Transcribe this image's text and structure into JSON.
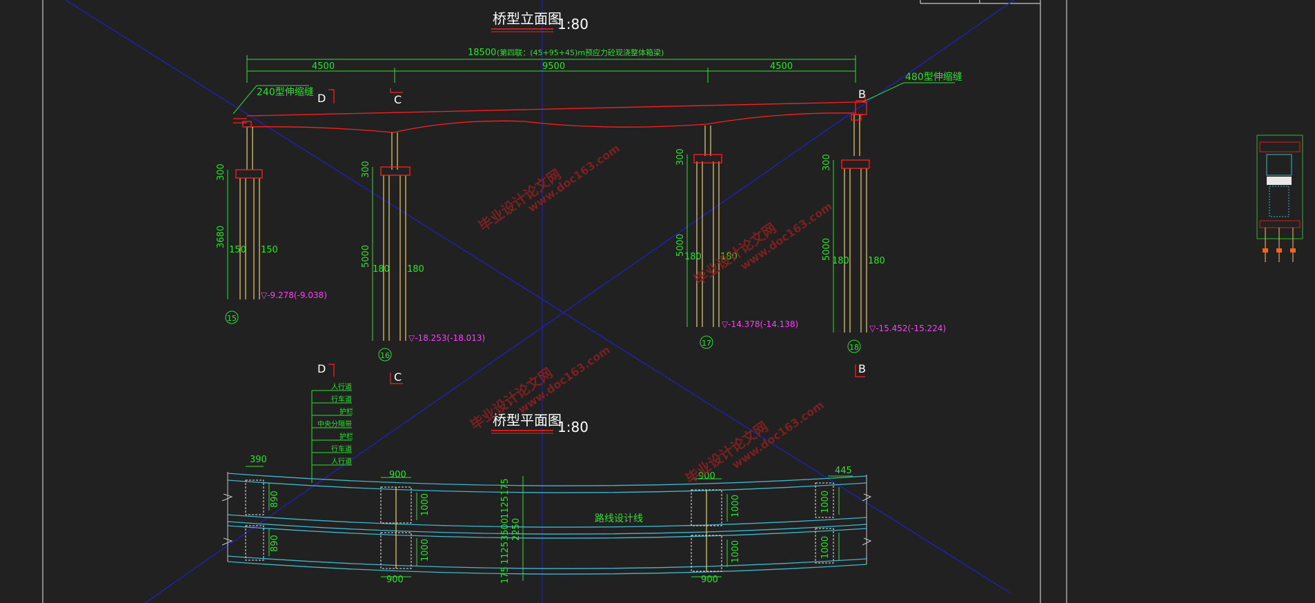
{
  "elevation": {
    "title": "桥型立面图",
    "scale": "1:80",
    "total_dim": "18500",
    "total_note": "(第四联：(45+95+45)m预应力砼现浇整体箱梁)",
    "span_left": "4500",
    "span_mid": "9500",
    "span_right": "4500",
    "joint_left": "240型伸缩缝",
    "joint_right": "480型伸缩缝",
    "sections": {
      "d": "D",
      "c": "C",
      "b": "B"
    },
    "piers": [
      {
        "id": "15",
        "cap": "300",
        "pile_len": "3680",
        "spacing_a": "150",
        "spacing_b": "150",
        "elev": "▽-9.278(-9.038)"
      },
      {
        "id": "16",
        "cap": "300",
        "pile_len": "5000",
        "spacing_a": "180",
        "spacing_b": "180",
        "elev": "▽-18.253(-18.013)"
      },
      {
        "id": "17",
        "cap": "300",
        "pile_len": "5000",
        "spacing_a": "180",
        "spacing_b": "180",
        "elev": "▽-14.378(-14.138)"
      },
      {
        "id": "18",
        "cap": "300",
        "pile_len": "5000",
        "spacing_a": "180",
        "spacing_b": "180",
        "elev": "▽-15.452(-15.224)"
      }
    ]
  },
  "plan": {
    "title": "桥型平面图",
    "scale": "1:80",
    "lanes": [
      "人行道",
      "行车道",
      "护栏",
      "中央分隔带",
      "护栏",
      "行车道",
      "人行道"
    ],
    "dim_left": "390",
    "dim_right": "445",
    "dim_900_a": "900",
    "dim_900_b": "900",
    "dim_900_c": "900",
    "dim_900_d": "900",
    "dim_890_a": "890",
    "dim_890_b": "890",
    "dim_1000": [
      "1000",
      "1000",
      "1000",
      "1000",
      "1000",
      "1000"
    ],
    "mid_dims": [
      "175",
      "1125",
      "3500",
      "2250",
      "1125",
      "175"
    ],
    "route_line": "路线设计线"
  },
  "watermark": {
    "site": "毕业设计论文网",
    "url": "www.doc163.com"
  },
  "colors": {
    "background": "#212121",
    "dimension": "#2ee12e",
    "structure": "#ff2020",
    "pile": "#f0d060",
    "axis": "#2020c0",
    "road": "#40b8d0",
    "elevation_mark": "#ff3cff"
  }
}
